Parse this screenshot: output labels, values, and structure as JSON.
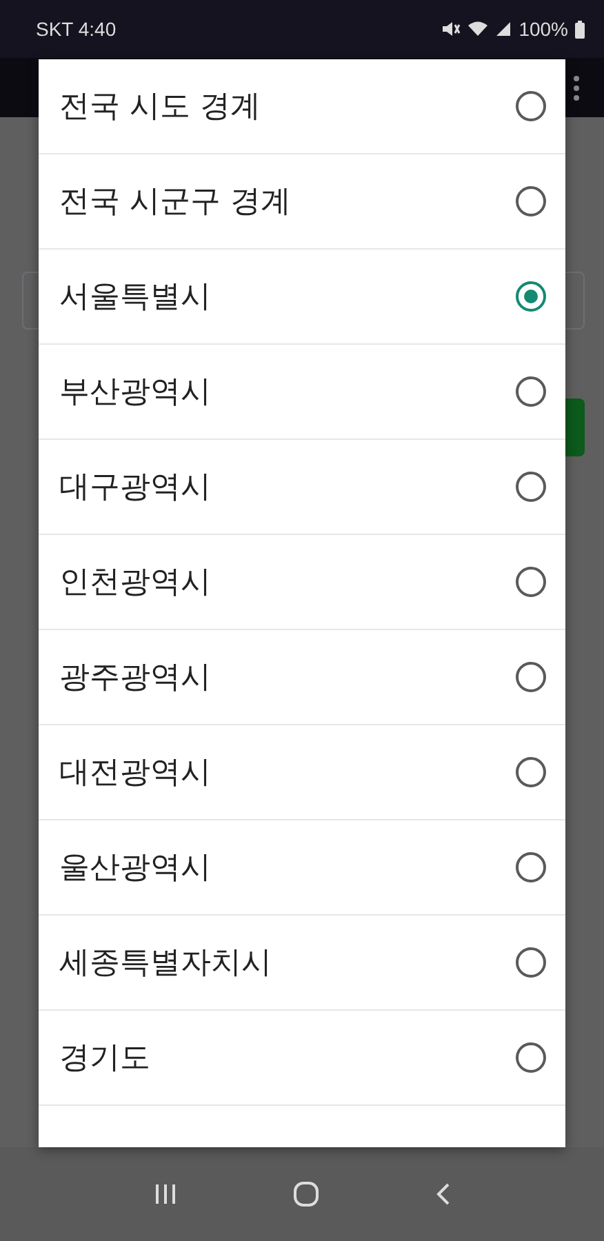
{
  "status_bar": {
    "carrier_time": "SKT 4:40",
    "battery": "100%"
  },
  "options": [
    {
      "label": "전국 시도 경계",
      "selected": false
    },
    {
      "label": "전국 시군구 경계",
      "selected": false
    },
    {
      "label": "서울특별시",
      "selected": true
    },
    {
      "label": "부산광역시",
      "selected": false
    },
    {
      "label": "대구광역시",
      "selected": false
    },
    {
      "label": "인천광역시",
      "selected": false
    },
    {
      "label": "광주광역시",
      "selected": false
    },
    {
      "label": "대전광역시",
      "selected": false
    },
    {
      "label": "울산광역시",
      "selected": false
    },
    {
      "label": "세종특별자치시",
      "selected": false
    },
    {
      "label": "경기도",
      "selected": false
    }
  ]
}
